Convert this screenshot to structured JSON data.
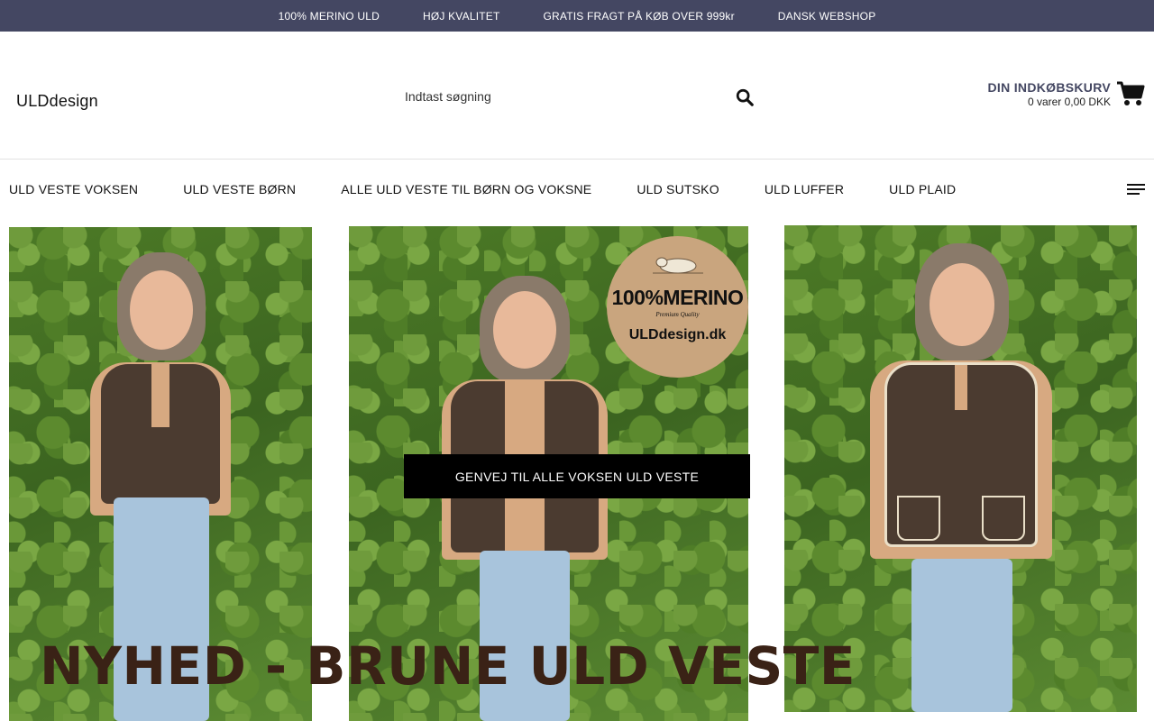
{
  "topbar": {
    "items": [
      "100% MERINO ULD",
      "HØJ KVALITET",
      "GRATIS FRAGT PÅ KØB OVER 999kr",
      "DANSK WEBSHOP"
    ]
  },
  "header": {
    "logo": "ULDdesign",
    "search_placeholder": "Indtast søgning",
    "cart": {
      "title": "DIN INDKØBSKURV",
      "summary": "0 varer 0,00 DKK"
    }
  },
  "nav": {
    "items": [
      "ULD VESTE VOKSEN",
      "ULD VESTE BØRN",
      "ALLE ULD VESTE TIL BØRN OG VOKSNE",
      "ULD SUTSKO",
      "ULD LUFFER",
      "ULD PLAID"
    ]
  },
  "hero": {
    "badge": {
      "big": "100%MERINO",
      "quality": "Premium Quality",
      "site": "ULDdesign.dk"
    },
    "cta": "GENVEJ TIL ALLE VOKSEN ULD VESTE",
    "banner": "NYHED - BRUNE ULD VESTE"
  },
  "colors": {
    "topbar_bg": "#444762",
    "cart_title": "#444762",
    "cta_bg": "#000000",
    "banner_text": "#3a2216"
  },
  "icons": {
    "search": "search-icon",
    "cart": "shopping-cart-icon",
    "menu": "hamburger-menu-icon"
  }
}
